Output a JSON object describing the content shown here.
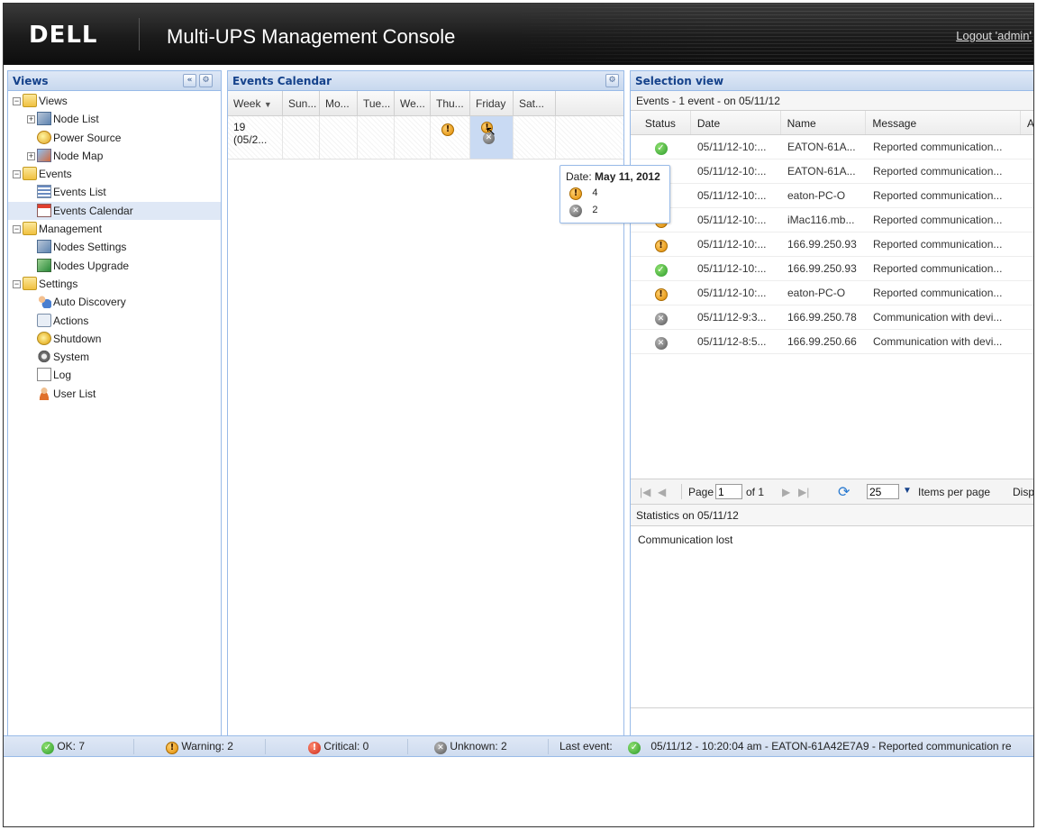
{
  "header": {
    "logo": "DELL",
    "title": "Multi-UPS Management Console",
    "logout": "Logout 'admin'"
  },
  "views_panel": {
    "title": "Views",
    "collapse_glyph": "«",
    "tree": [
      {
        "label": "Views",
        "icon": "folder-icon",
        "level": 0
      },
      {
        "label": "Node List",
        "icon": "node-list-icon",
        "level": 1
      },
      {
        "label": "Power Source",
        "icon": "power-source-icon",
        "level": 1
      },
      {
        "label": "Node Map",
        "icon": "node-map-icon",
        "level": 1
      },
      {
        "label": "Events",
        "icon": "folder-icon",
        "level": 0
      },
      {
        "label": "Events List",
        "icon": "events-list-icon",
        "level": 1
      },
      {
        "label": "Events Calendar",
        "icon": "events-calendar-icon",
        "level": 1
      },
      {
        "label": "Management",
        "icon": "folder-icon",
        "level": 0
      },
      {
        "label": "Nodes Settings",
        "icon": "nodes-settings-icon",
        "level": 1
      },
      {
        "label": "Nodes Upgrade",
        "icon": "nodes-upgrade-icon",
        "level": 1
      },
      {
        "label": "Settings",
        "icon": "folder-icon",
        "level": 0
      },
      {
        "label": "Auto Discovery",
        "icon": "auto-discovery-icon",
        "level": 1
      },
      {
        "label": "Actions",
        "icon": "actions-icon",
        "level": 1
      },
      {
        "label": "Shutdown",
        "icon": "shutdown-icon",
        "level": 1
      },
      {
        "label": "System",
        "icon": "system-icon",
        "level": 1
      },
      {
        "label": "Log",
        "icon": "log-icon",
        "level": 1
      },
      {
        "label": "User List",
        "icon": "user-list-icon",
        "level": 1
      }
    ]
  },
  "calendar_panel": {
    "title": "Events Calendar",
    "columns": [
      "Week",
      "Sun...",
      "Mo...",
      "Tue...",
      "We...",
      "Thu...",
      "Friday",
      "Sat..."
    ],
    "week_label": "19 (05/2...",
    "tooltip": {
      "date_prefix": "Date:",
      "date": "May 11, 2012",
      "warning_count": "4",
      "unknown_count": "2"
    }
  },
  "selection_panel": {
    "title": "Selection view",
    "events_summary": "Events - 1 event - on 05/11/12",
    "columns": [
      "Status",
      "Date",
      "Name",
      "Message",
      "A"
    ],
    "rows": [
      {
        "status": "ok",
        "date": "05/11/12-10:...",
        "name": "EATON-61A...",
        "message": "Reported communication..."
      },
      {
        "status": "ok",
        "date": "05/11/12-10:...",
        "name": "EATON-61A...",
        "message": "Reported communication..."
      },
      {
        "status": "ok",
        "date": "05/11/12-10:...",
        "name": "eaton-PC-O",
        "message": "Reported communication..."
      },
      {
        "status": "warn",
        "date": "05/11/12-10:...",
        "name": "iMac116.mb...",
        "message": "Reported communication..."
      },
      {
        "status": "warn",
        "date": "05/11/12-10:...",
        "name": "166.99.250.93",
        "message": "Reported communication..."
      },
      {
        "status": "ok",
        "date": "05/11/12-10:...",
        "name": "166.99.250.93",
        "message": "Reported communication..."
      },
      {
        "status": "warn",
        "date": "05/11/12-10:...",
        "name": "eaton-PC-O",
        "message": "Reported communication..."
      },
      {
        "status": "unk",
        "date": "05/11/12-9:3...",
        "name": "166.99.250.78",
        "message": "Communication with devi..."
      },
      {
        "status": "unk",
        "date": "05/11/12-8:5...",
        "name": "166.99.250.66",
        "message": "Communication with devi..."
      }
    ],
    "pager": {
      "page_label": "Page",
      "page_value": "1",
      "of_label": "of 1",
      "per_page_value": "25",
      "per_page_label": "Items per page",
      "display_label": "Disp"
    },
    "stats_title": "Statistics on 05/11/12",
    "stats_text": "Communication lost"
  },
  "status_bar": {
    "ok": "OK: 7",
    "warning": "Warning: 2",
    "critical": "Critical: 0",
    "unknown": "Unknown: 2",
    "last_event_label": "Last event:",
    "last_event_text": "05/11/12 - 10:20:04 am - EATON-61A42E7A9 - Reported communication re"
  }
}
